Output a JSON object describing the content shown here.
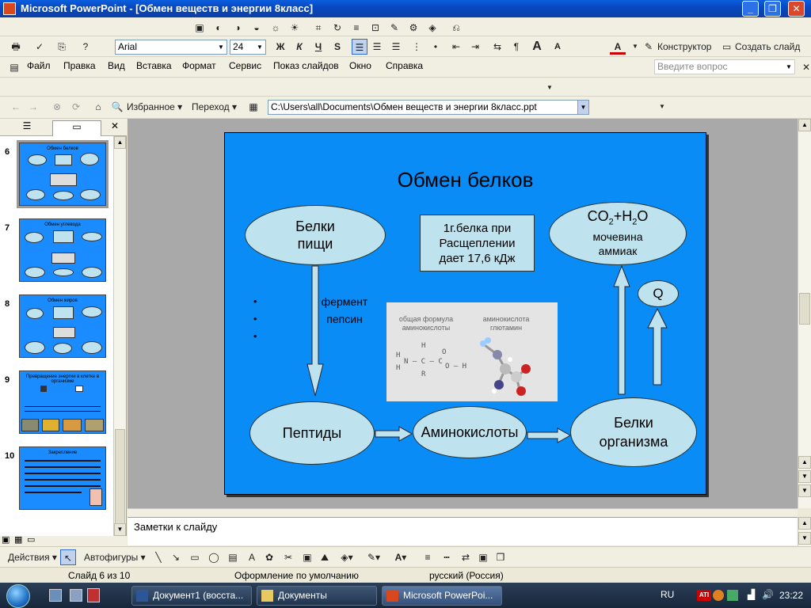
{
  "window": {
    "title": "Microsoft PowerPoint - [Обмен веществ и энергии 8класс]"
  },
  "format_toolbar": {
    "font": "Arial",
    "size": "24",
    "bold": "Ж",
    "italic": "К",
    "underline": "Ч",
    "shadow": "S",
    "designer": "Конструктор",
    "new_slide": "Создать слайд"
  },
  "menu": {
    "items": [
      "Файл",
      "Правка",
      "Вид",
      "Вставка",
      "Формат",
      "Сервис",
      "Показ слайдов",
      "Окно",
      "Справка"
    ],
    "ask_placeholder": "Введите вопрос"
  },
  "web_toolbar": {
    "favorites": "Избранное",
    "go": "Переход",
    "address": "C:\\Users\\all\\Documents\\Обмен веществ и энергии 8класс.ppt"
  },
  "slides_panel": {
    "thumbs": [
      {
        "num": "6",
        "title": "Обмен белков"
      },
      {
        "num": "7",
        "title": "Обмен углевода"
      },
      {
        "num": "8",
        "title": "Обмен жиров"
      },
      {
        "num": "9",
        "title": "Превращение энергии в клетке в организме"
      },
      {
        "num": "10",
        "title": "Закрепление"
      }
    ]
  },
  "slide": {
    "title": "Обмен белков",
    "food_proteins": {
      "l1": "Белки",
      "l2": "пищи"
    },
    "energy_box": {
      "l1": "1г.белка при",
      "l2": "Расщеплении",
      "l3": "дает 17,6 кДж"
    },
    "products": {
      "co2_a": "CO",
      "co2_sub": "2",
      "co2_b": "+H",
      "h2o_sub": "2",
      "co2_c": "O",
      "l2": "мочевина",
      "l3": "аммиак"
    },
    "q": "Q",
    "enzyme": {
      "l1": "фермент",
      "l2": "пепсин"
    },
    "bullets": [
      "•",
      "•",
      "•"
    ],
    "peptides": "Пептиды",
    "amino_acids": "Аминокислоты",
    "body_proteins": {
      "l1": "Белки",
      "l2": "организма"
    },
    "image": {
      "caption_left": {
        "l1": "общая формула",
        "l2": "аминокислоты"
      },
      "caption_right": {
        "l1": "аминокислота",
        "l2": "глютамин"
      },
      "formula": {
        "h_top": "H",
        "o_top": "O",
        "h_n": "H",
        "n_row": "N – C – C",
        "oh": "O – H",
        "h_bottom": "H",
        "r": "R"
      }
    }
  },
  "notes": {
    "placeholder": "Заметки к слайду"
  },
  "drawing_toolbar": {
    "actions": "Действия",
    "autoshapes": "Автофигуры"
  },
  "status": {
    "slide": "Слайд 6 из 10",
    "design": "Оформление по умолчанию",
    "lang": "русский (Россия)"
  },
  "taskbar": {
    "tasks": [
      "Документ1 (восста...",
      "Документы",
      "Microsoft PowerPoi..."
    ],
    "lang": "RU",
    "clock": "23:22"
  }
}
